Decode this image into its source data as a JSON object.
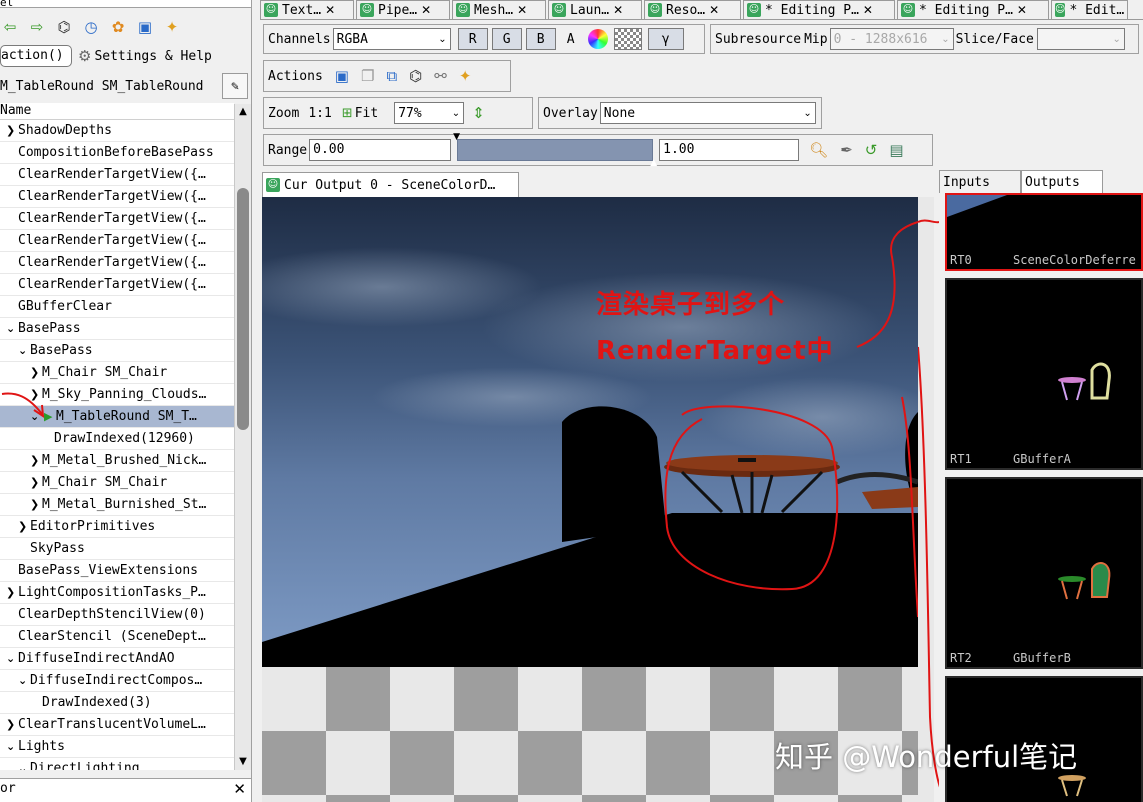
{
  "left_panel": {
    "title_fragment": "el",
    "toolbar_icons": [
      "back-arrow-icon",
      "forward-arrow-icon",
      "binoculars-icon",
      "clock-icon",
      "flower-icon",
      "save-icon",
      "puzzle-icon"
    ],
    "action_select": "action()",
    "settings_label": "Settings & Help",
    "marker_text": "M_TableRound SM_TableRound",
    "tree_header": "Name",
    "tree": [
      {
        "label": "ShadowDepths",
        "indent": 1,
        "arrow": "›"
      },
      {
        "label": "CompositionBeforeBasePass",
        "indent": 1,
        "arrow": ""
      },
      {
        "label": "ClearRenderTargetView({…",
        "indent": 1,
        "arrow": ""
      },
      {
        "label": "ClearRenderTargetView({…",
        "indent": 1,
        "arrow": ""
      },
      {
        "label": "ClearRenderTargetView({…",
        "indent": 1,
        "arrow": ""
      },
      {
        "label": "ClearRenderTargetView({…",
        "indent": 1,
        "arrow": ""
      },
      {
        "label": "ClearRenderTargetView({…",
        "indent": 1,
        "arrow": ""
      },
      {
        "label": "ClearRenderTargetView({…",
        "indent": 1,
        "arrow": ""
      },
      {
        "label": "GBufferClear",
        "indent": 1,
        "arrow": ""
      },
      {
        "label": "BasePass",
        "indent": 1,
        "arrow": "⌄"
      },
      {
        "label": "BasePass",
        "indent": 2,
        "arrow": "⌄"
      },
      {
        "label": "M_Chair SM_Chair",
        "indent": 3,
        "arrow": "›"
      },
      {
        "label": "M_Sky_Panning_Clouds…",
        "indent": 3,
        "arrow": "›"
      },
      {
        "label": "M_TableRound SM_T…",
        "indent": 3,
        "arrow": "⌄",
        "selected": true
      },
      {
        "label": "DrawIndexed(12960)",
        "indent": 4,
        "arrow": ""
      },
      {
        "label": "M_Metal_Brushed_Nick…",
        "indent": 3,
        "arrow": "›"
      },
      {
        "label": "M_Chair SM_Chair",
        "indent": 3,
        "arrow": "›"
      },
      {
        "label": "M_Metal_Burnished_St…",
        "indent": 3,
        "arrow": "›"
      },
      {
        "label": "EditorPrimitives",
        "indent": 2,
        "arrow": "›"
      },
      {
        "label": "SkyPass",
        "indent": 2,
        "arrow": ""
      },
      {
        "label": "BasePass_ViewExtensions",
        "indent": 1,
        "arrow": ""
      },
      {
        "label": "LightCompositionTasks_P…",
        "indent": 1,
        "arrow": "›"
      },
      {
        "label": "ClearDepthStencilView(0)",
        "indent": 1,
        "arrow": ""
      },
      {
        "label": "ClearStencil (SceneDept…",
        "indent": 1,
        "arrow": ""
      },
      {
        "label": "DiffuseIndirectAndAO",
        "indent": 1,
        "arrow": "⌄"
      },
      {
        "label": "DiffuseIndirectCompos…",
        "indent": 2,
        "arrow": "⌄"
      },
      {
        "label": "DrawIndexed(3)",
        "indent": 3,
        "arrow": ""
      },
      {
        "label": "ClearTranslucentVolumeL…",
        "indent": 1,
        "arrow": "›"
      },
      {
        "label": "Lights",
        "indent": 1,
        "arrow": "⌄"
      },
      {
        "label": "DirectLighting",
        "indent": 2,
        "arrow": "⌄"
      }
    ],
    "bottom_title": "or"
  },
  "tabs": [
    {
      "label": "Text…"
    },
    {
      "label": "Pipe…"
    },
    {
      "label": "Mesh…"
    },
    {
      "label": "Laun…"
    },
    {
      "label": "Reso…"
    },
    {
      "label": "* Editing P…"
    },
    {
      "label": "* Editing P…"
    },
    {
      "label": "* Edit…"
    }
  ],
  "channels": {
    "label": "Channels",
    "value": "RGBA",
    "r": "R",
    "g": "G",
    "b": "B",
    "a": "A",
    "gamma": "γ",
    "subresource_label": "Subresource",
    "mip_label": "Mip",
    "mip_value": "0 - 1288x616",
    "slice_label": "Slice/Face",
    "slice_value": ""
  },
  "actions": {
    "label": "Actions"
  },
  "zoom": {
    "label": "Zoom",
    "ratio": "1:1",
    "fit": "Fit",
    "value": "77%",
    "overlay_label": "Overlay",
    "overlay_value": "None"
  },
  "range": {
    "label": "Range",
    "min": "0.00",
    "max": "1.00"
  },
  "viewer": {
    "tab_label": "Cur Output 0 - SceneColorD…"
  },
  "side_tabs": {
    "inputs": "Inputs",
    "outputs": "Outputs"
  },
  "thumbnails": [
    {
      "rt": "RT0",
      "name": "SceneColorDeferre"
    },
    {
      "rt": "RT1",
      "name": "GBufferA"
    },
    {
      "rt": "RT2",
      "name": "GBufferB"
    },
    {
      "rt": "",
      "name": ""
    }
  ],
  "annotation": {
    "line1": "渲染桌子到多个",
    "line2": "RenderTarget中"
  },
  "watermark": "知乎 @Wonderful笔记"
}
